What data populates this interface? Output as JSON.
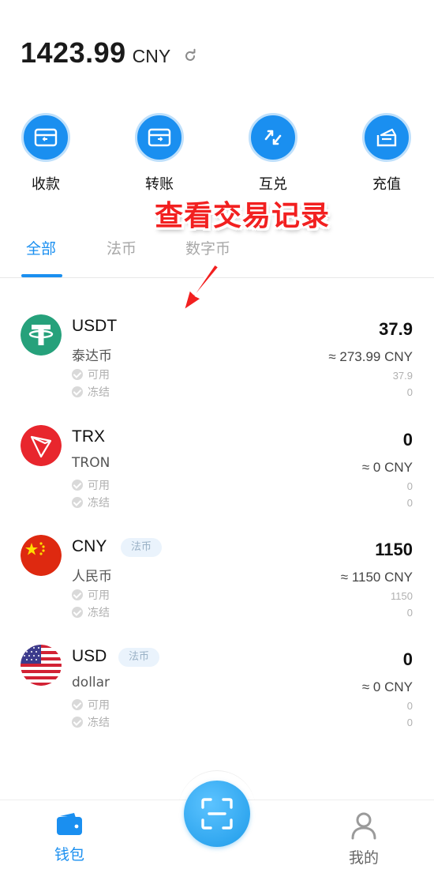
{
  "header": {
    "balance": "1423.99",
    "unit": "CNY",
    "refresh_icon": "refresh-icon"
  },
  "actions": [
    {
      "label": "收款",
      "icon": "receive-icon"
    },
    {
      "label": "转账",
      "icon": "transfer-icon"
    },
    {
      "label": "互兑",
      "icon": "exchange-icon"
    },
    {
      "label": "充值",
      "icon": "topup-icon"
    }
  ],
  "overlay": {
    "text": "查看交易记录",
    "color": "#f22020"
  },
  "tabs": [
    {
      "label": "全部",
      "active": true
    },
    {
      "label": "法币",
      "active": false
    },
    {
      "label": "数字币",
      "active": false
    }
  ],
  "assets": [
    {
      "symbol": "USDT",
      "name": "泰达币",
      "tag": "",
      "total": "37.9",
      "approx": "≈ 273.99 CNY",
      "available_label": "可用",
      "frozen_label": "冻结",
      "available": "37.9",
      "frozen": "0",
      "icon": "tether-icon"
    },
    {
      "symbol": "TRX",
      "name": "TRON",
      "tag": "",
      "total": "0",
      "approx": "≈ 0 CNY",
      "available_label": "可用",
      "frozen_label": "冻结",
      "available": "0",
      "frozen": "0",
      "icon": "tron-icon"
    },
    {
      "symbol": "CNY",
      "name": "人民币",
      "tag": "法币",
      "total": "1150",
      "approx": "≈ 1150 CNY",
      "available_label": "可用",
      "frozen_label": "冻结",
      "available": "1150",
      "frozen": "0",
      "icon": "china-flag-icon"
    },
    {
      "symbol": "USD",
      "name": "dollar",
      "tag": "法币",
      "total": "0",
      "approx": "≈ 0 CNY",
      "available_label": "可用",
      "frozen_label": "冻结",
      "available": "0",
      "frozen": "0",
      "icon": "us-flag-icon"
    }
  ],
  "bottom_nav": {
    "wallet_label": "钱包",
    "mine_label": "我的",
    "scan_icon": "scan-icon",
    "active_color": "#1a8ff0"
  }
}
